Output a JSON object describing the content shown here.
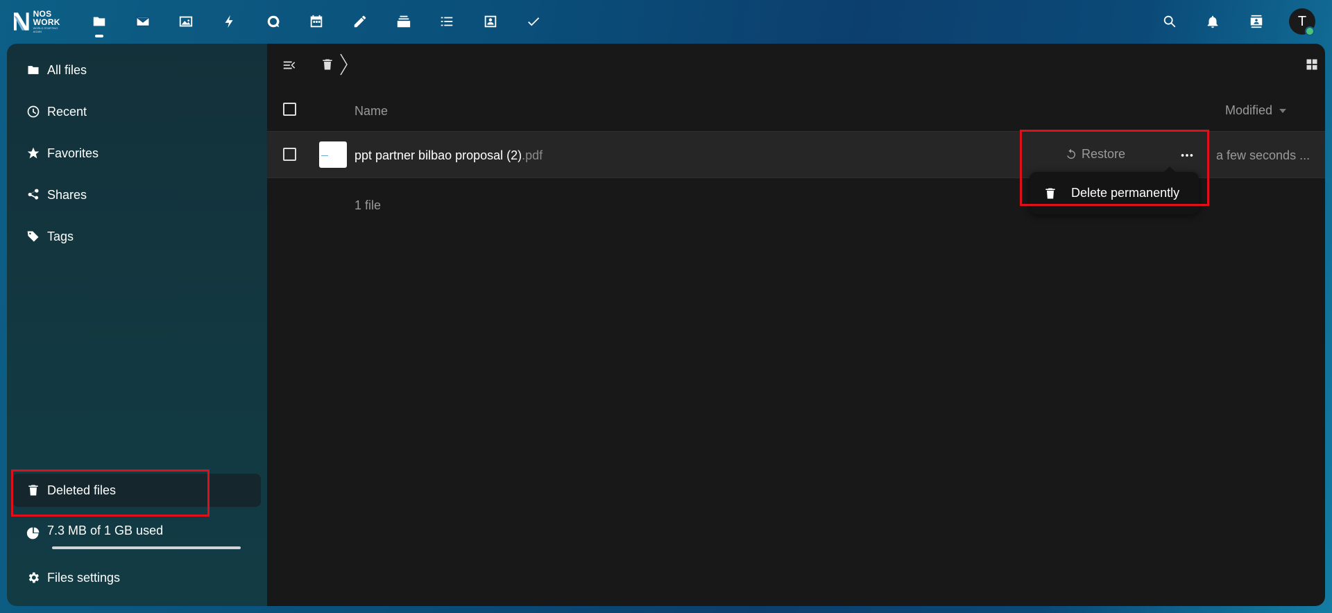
{
  "topbar": {
    "logo": {
      "line1": "NOS",
      "line2": "WORK",
      "tagline": "WORLD STARTING AGAIN"
    },
    "apps": [
      {
        "icon": "folder-icon",
        "active": true
      },
      {
        "icon": "mail-icon"
      },
      {
        "icon": "image-icon"
      },
      {
        "icon": "lightning-icon"
      },
      {
        "icon": "talk-icon"
      },
      {
        "icon": "calendar-icon"
      },
      {
        "icon": "pencil-icon"
      },
      {
        "icon": "deck-icon"
      },
      {
        "icon": "list-icon"
      },
      {
        "icon": "contacts-icon"
      },
      {
        "icon": "checkmark-icon"
      }
    ],
    "right_icons": [
      "search-icon",
      "bell-icon",
      "contacts-menu-icon"
    ],
    "avatar_initial": "T",
    "status_color": "#4ec277"
  },
  "sidebar": {
    "items": [
      {
        "label": "All files",
        "icon": "folder-icon"
      },
      {
        "label": "Recent",
        "icon": "clock-icon"
      },
      {
        "label": "Favorites",
        "icon": "star-icon"
      },
      {
        "label": "Shares",
        "icon": "share-icon"
      },
      {
        "label": "Tags",
        "icon": "tag-icon"
      }
    ],
    "deleted": {
      "label": "Deleted files",
      "icon": "trash-icon",
      "active": true
    },
    "quota": {
      "label": "7.3 MB of 1 GB used",
      "icon": "pie-chart-icon",
      "fraction_used": 0.0073
    },
    "settings": {
      "label": "Files settings",
      "icon": "gear-icon"
    }
  },
  "main": {
    "columns": {
      "name": "Name",
      "modified": "Modified"
    },
    "files": [
      {
        "basename": "ppt partner bilbao proposal (2)",
        "extension": ".pdf",
        "restore_label": "Restore",
        "modified": "a few seconds ..."
      }
    ],
    "menu": {
      "delete_label": "Delete permanently"
    },
    "summary": "1 file"
  },
  "colors": {
    "highlight": "#e0101a",
    "background": "#181818"
  }
}
